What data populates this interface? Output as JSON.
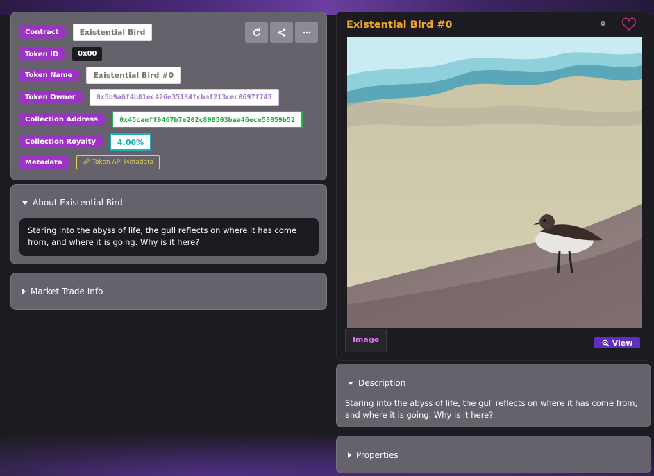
{
  "token": {
    "contract_label": "Contract",
    "contract_value": "Existential Bird",
    "token_id_label": "Token ID",
    "token_id_value": "0x00",
    "token_name_label": "Token Name",
    "token_name_value": "Existential Bird #0",
    "owner_label": "Token Owner",
    "owner_value": "0x5b9a6f4b81ec426e35134fcbaf213cec0697f745",
    "collection_address_label": "Collection Address",
    "collection_address_value": "0x45caeff9467b7e202c808503baa46ece58059b52",
    "royalty_label": "Collection Royalty",
    "royalty_value": "4.00%",
    "metadata_label": "Metadata",
    "metadata_link": "Token API Metadata"
  },
  "toolbar": {
    "icons": [
      "refresh-icon",
      "share-icon",
      "more-icon"
    ]
  },
  "about": {
    "header": "About Existential Bird",
    "text": "Staring into the abyss of life, the gull reflects on where it has come from, and where it is going. Why is it here?"
  },
  "market": {
    "header": "Market Trade Info"
  },
  "nft": {
    "title": "Existential Bird #0",
    "like_count": "0",
    "tab_image": "Image",
    "view_label": "View"
  },
  "description": {
    "header": "Description",
    "text": "Staring into the abyss of life, the gull reflects on where it has come from, and where it is going. Why is it here?"
  },
  "properties": {
    "header": "Properties"
  },
  "colors": {
    "tag_purple": "#9b34c4",
    "title_orange": "#f0a62b",
    "view_purple": "#5e2fc2",
    "panel_gray": "#65626b"
  }
}
